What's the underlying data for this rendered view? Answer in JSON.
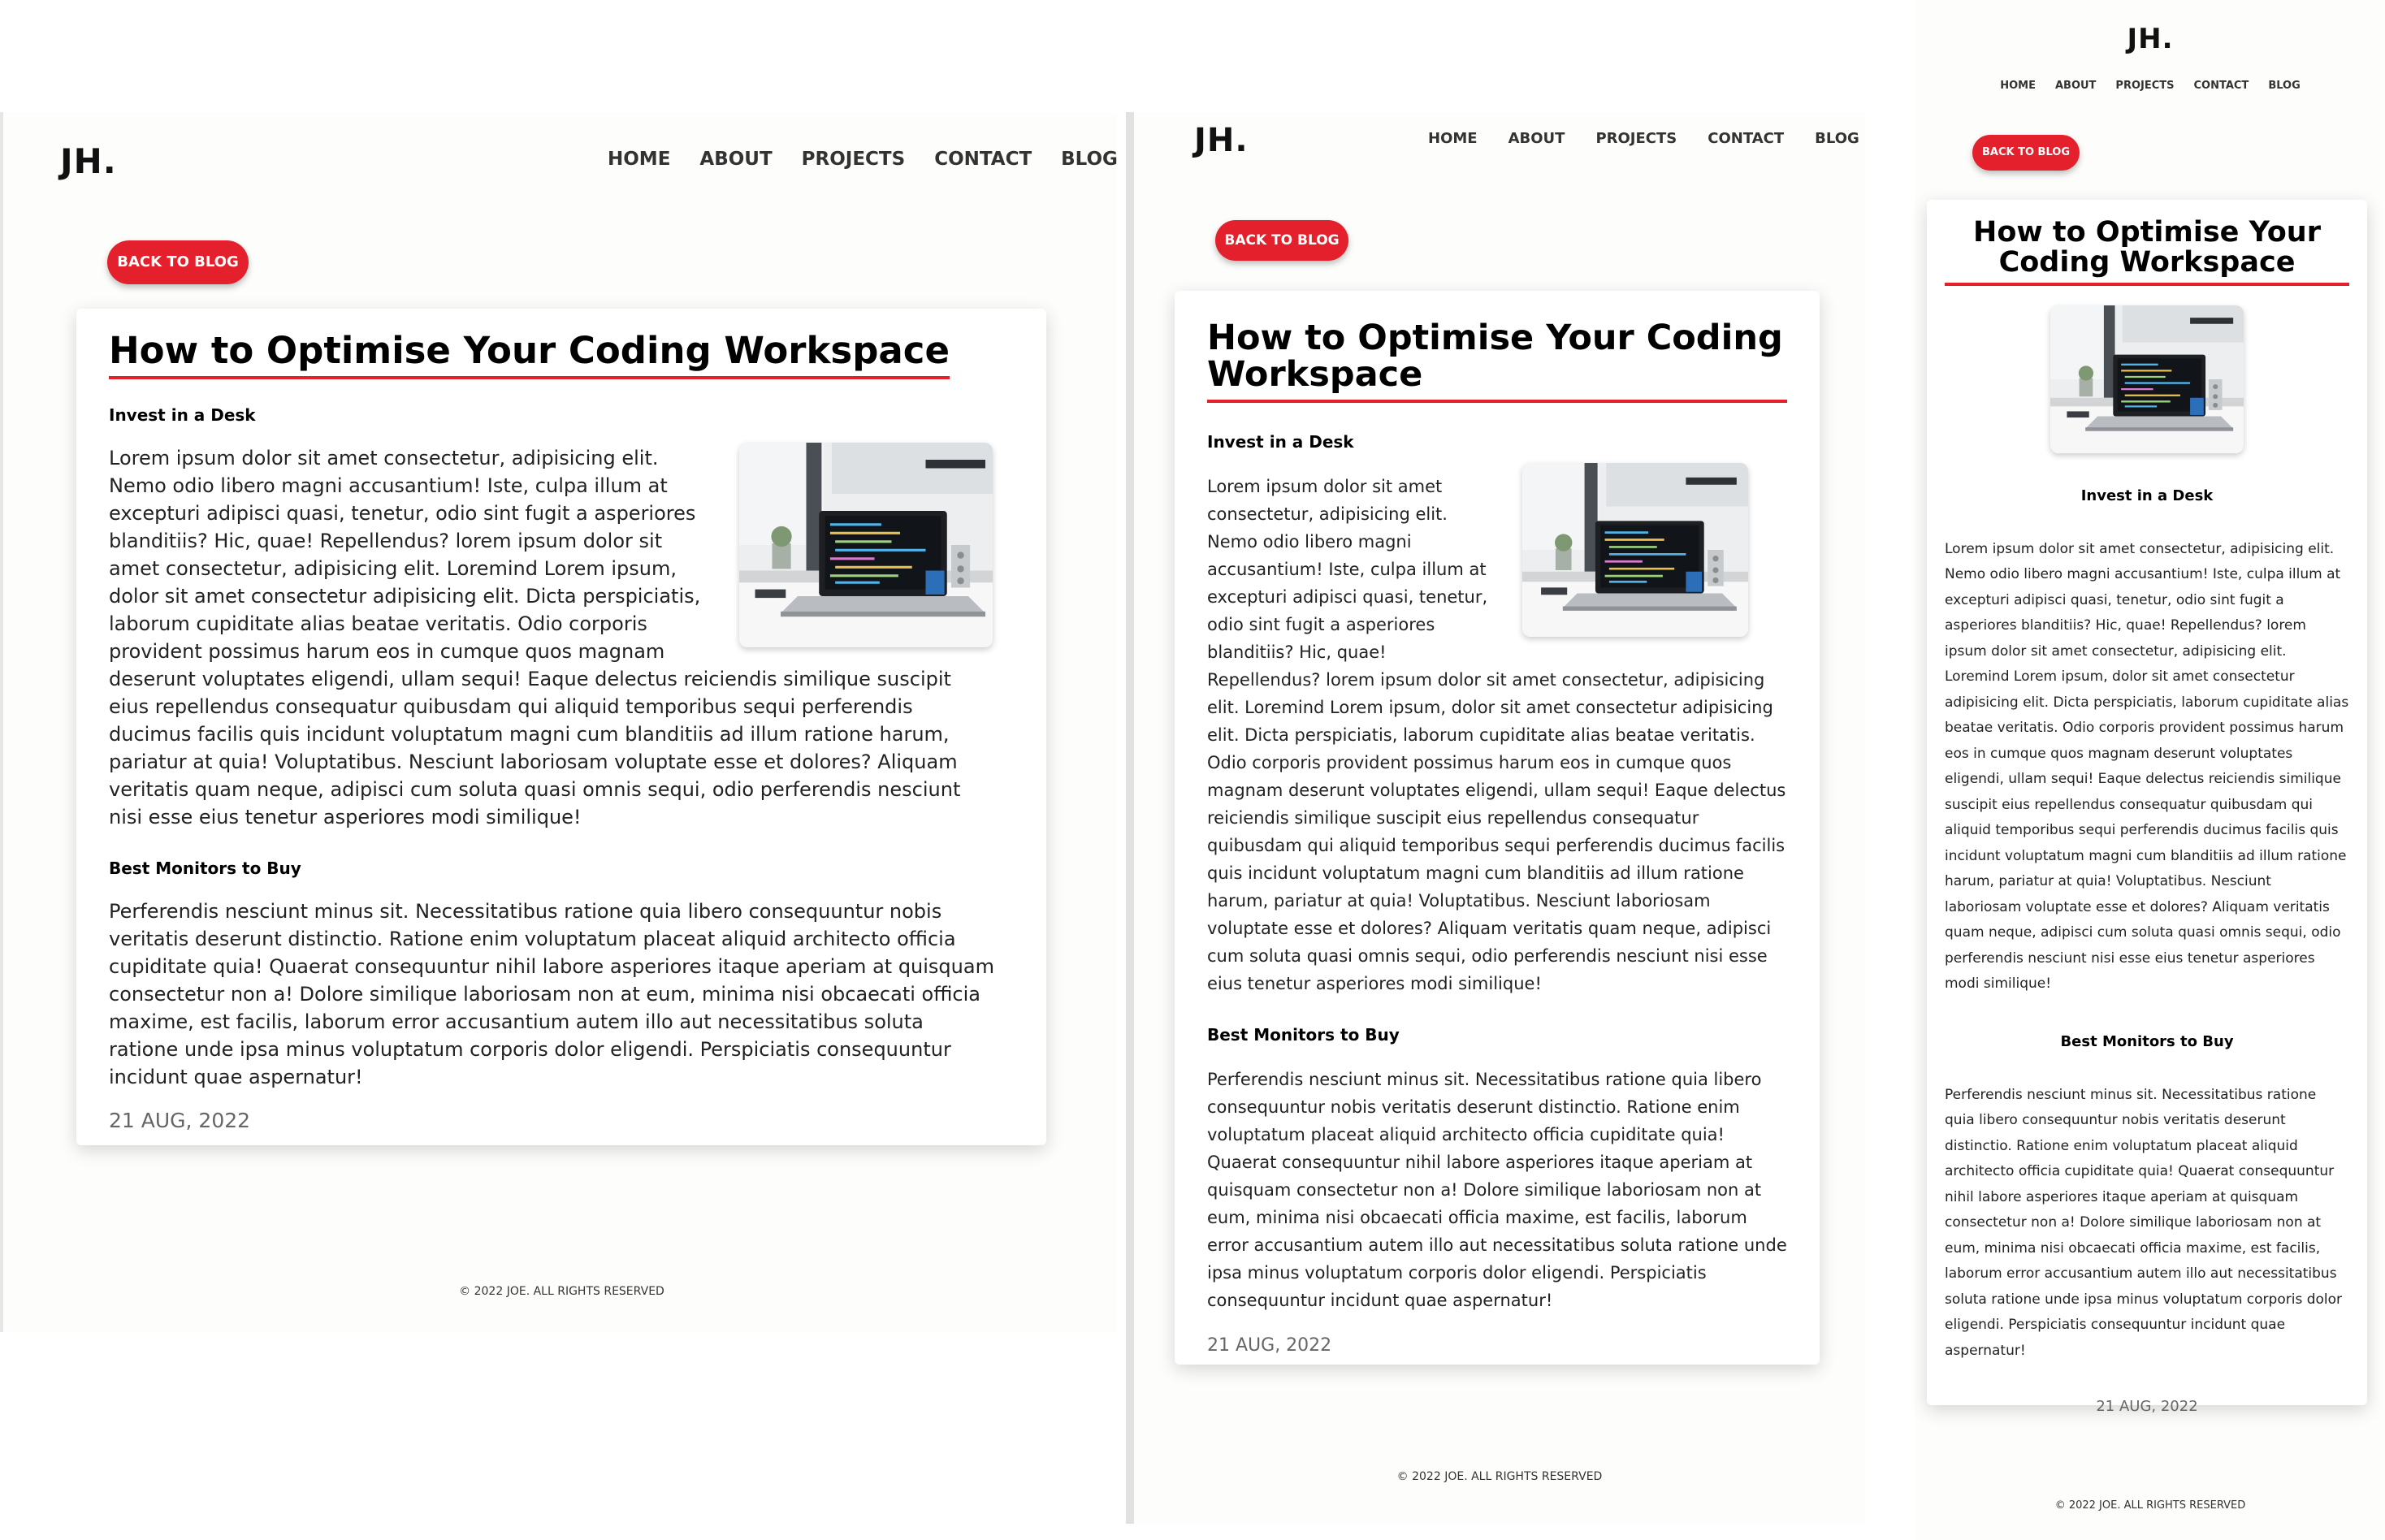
{
  "site": {
    "logo": "JH.",
    "nav": [
      "HOME",
      "ABOUT",
      "PROJECTS",
      "CONTACT",
      "BLOG"
    ],
    "back_button": "BACK TO BLOG",
    "footer": "© 2022 JOE. ALL RIGHTS RESERVED"
  },
  "post": {
    "title": "How to Optimise Your Coding Workspace",
    "section1_heading": "Invest in a Desk",
    "section1_text": "Lorem ipsum dolor sit amet consectetur, adipisicing elit. Nemo odio libero magni accusantium! Iste, culpa illum at excepturi adipisci quasi, tenetur, odio sint fugit a asperiores blanditiis? Hic, quae! Repellendus? lorem ipsum dolor sit amet consectetur, adipisicing elit. Loremind Lorem ipsum, dolor sit amet consectetur adipisicing elit. Dicta perspiciatis, laborum cupiditate alias beatae veritatis. Odio corporis provident possimus harum eos in cumque quos magnam deserunt voluptates eligendi, ullam sequi! Eaque delectus reiciendis similique suscipit eius repellendus consequatur quibusdam qui aliquid temporibus sequi perferendis ducimus facilis quis incidunt voluptatum magni cum blanditiis ad illum ratione harum, pariatur at quia! Voluptatibus. Nesciunt laboriosam voluptate esse et dolores? Aliquam veritatis quam neque, adipisci cum soluta quasi omnis sequi, odio perferendis nesciunt nisi esse eius tenetur asperiores modi similique!",
    "section2_heading": "Best Monitors to Buy",
    "section2_text": "Perferendis nesciunt minus sit. Necessitatibus ratione quia libero consequuntur nobis veritatis deserunt distinctio. Ratione enim voluptatum placeat aliquid architecto officia cupiditate quia! Quaerat consequuntur nihil labore asperiores itaque aperiam at quisquam consectetur non a! Dolore similique laboriosam non at eum, minima nisi obcaecati officia maxime, est facilis, laborum error accusantium autem illo aut necessitatibus soluta ratione unde ipsa minus voluptatum corporis dolor eligendi. Perspiciatis consequuntur incidunt quae aspernatur!",
    "date": "21 AUG, 2022",
    "image_icon": "laptop-desk-photo"
  },
  "colors": {
    "accent": "#e3202b",
    "background": "#fdfdfb",
    "card": "#ffffff"
  }
}
